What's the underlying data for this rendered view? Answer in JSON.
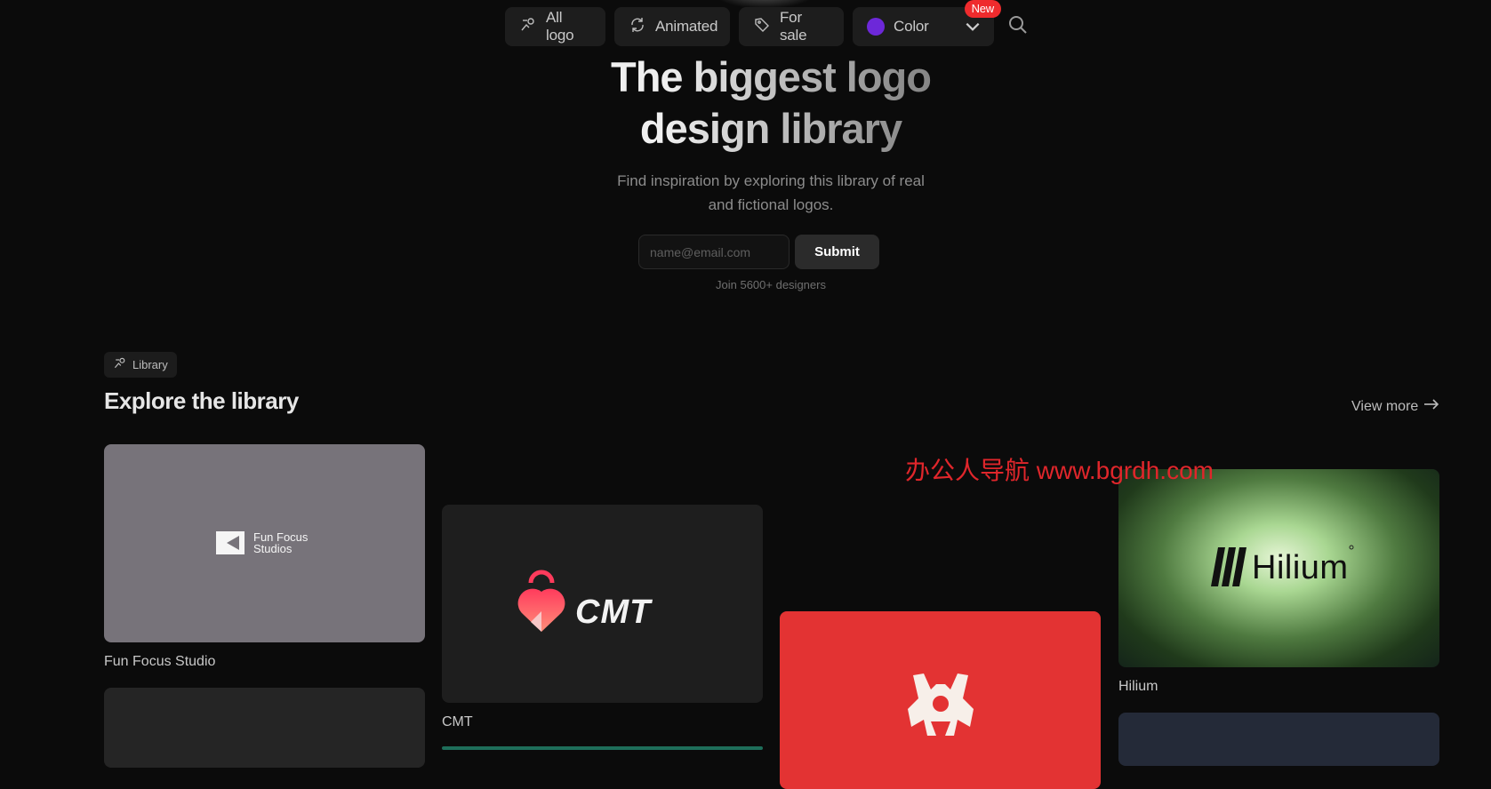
{
  "nav": {
    "items": [
      {
        "label": "All logo",
        "icon": "logo-icon"
      },
      {
        "label": "Animated",
        "icon": "refresh-icon"
      },
      {
        "label": "For sale",
        "icon": "tag-icon"
      }
    ],
    "color_filter": {
      "label": "Color",
      "dot_color": "#6d28d9",
      "badge": "New"
    }
  },
  "hero": {
    "title_line1": "The biggest logo",
    "title_line2": "design library",
    "subtitle_line1": "Find inspiration by exploring this library of real",
    "subtitle_line2": "and fictional logos.",
    "email_placeholder": "name@email.com",
    "submit_label": "Submit",
    "join_text": "Join 5600+ designers"
  },
  "library": {
    "chip_label": "Library",
    "title": "Explore the library",
    "view_more": "View more",
    "cards": [
      {
        "name": "Fun Focus Studio",
        "logo_text_1": "Fun Focus",
        "logo_text_2": "Studios"
      },
      {
        "name": "CMT",
        "logo_text": "CMT"
      },
      {
        "name": "",
        "logo_text": ""
      },
      {
        "name": "Hilium",
        "logo_text": "Hilium"
      }
    ]
  },
  "watermark": "办公人导航 www.bgrdh.com",
  "colors": {
    "background": "#0b0b0b",
    "badge": "#ef2b2d",
    "accent_red_card": "#e33333"
  }
}
